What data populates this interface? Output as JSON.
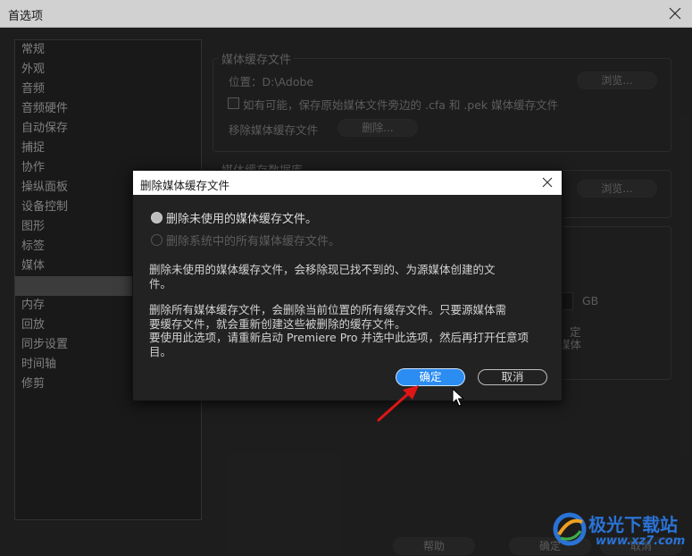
{
  "window": {
    "title": "首选项"
  },
  "sidebar": {
    "items": [
      {
        "label": "常规"
      },
      {
        "label": "外观"
      },
      {
        "label": "音频"
      },
      {
        "label": "音频硬件"
      },
      {
        "label": "自动保存"
      },
      {
        "label": "捕捉"
      },
      {
        "label": "协作"
      },
      {
        "label": "操纵面板"
      },
      {
        "label": "设备控制"
      },
      {
        "label": "图形"
      },
      {
        "label": "标签"
      },
      {
        "label": "媒体"
      },
      {
        "label": ""
      },
      {
        "label": "内存"
      },
      {
        "label": "回放"
      },
      {
        "label": "同步设置"
      },
      {
        "label": "时间轴"
      },
      {
        "label": "修剪"
      }
    ]
  },
  "media_cache_files": {
    "title": "媒体缓存文件",
    "location_label": "位置：D:\\Adobe",
    "browse": "浏览...",
    "checkbox_label": "如有可能，保存原始媒体文件旁边的 .cfa 和 .pek 媒体缓存文件",
    "remove_label": "移除媒体缓存文件",
    "delete": "删除..."
  },
  "media_cache_db": {
    "title": "媒体缓存数据库",
    "browse": "浏览..."
  },
  "background_fragments": {
    "gb": "GB",
    "ding": "定",
    "meiti": "媒体"
  },
  "footer": {
    "help": "帮助",
    "ok": "确定",
    "cancel": "取消"
  },
  "dialog": {
    "title": "删除媒体缓存文件",
    "options": [
      {
        "label": "删除未使用的媒体缓存文件。",
        "selected": true
      },
      {
        "label": "删除系统中的所有媒体缓存文件。",
        "selected": false
      }
    ],
    "paragraph1": "删除未使用的媒体缓存文件，会移除现已找不到的、为源媒体创建的文\n件。",
    "paragraph2": "删除所有媒体缓存文件，会删除当前位置的所有缓存文件。只要源媒体需\n要缓存文件，就会重新创建这些被删除的缓存文件。\n要使用此选项，请重新启动 Premiere Pro 并选中此选项，然后再打开任意项\n目。",
    "ok": "确定",
    "cancel": "取消"
  },
  "watermark": {
    "text": "极光下载站",
    "sub": "www.xz7.com"
  },
  "colors": {
    "accent": "#2b8cf2",
    "dialog_bg": "#222222",
    "panel_bg": "#242424",
    "arrow": "#e01515",
    "logo": "#2a73d6"
  }
}
